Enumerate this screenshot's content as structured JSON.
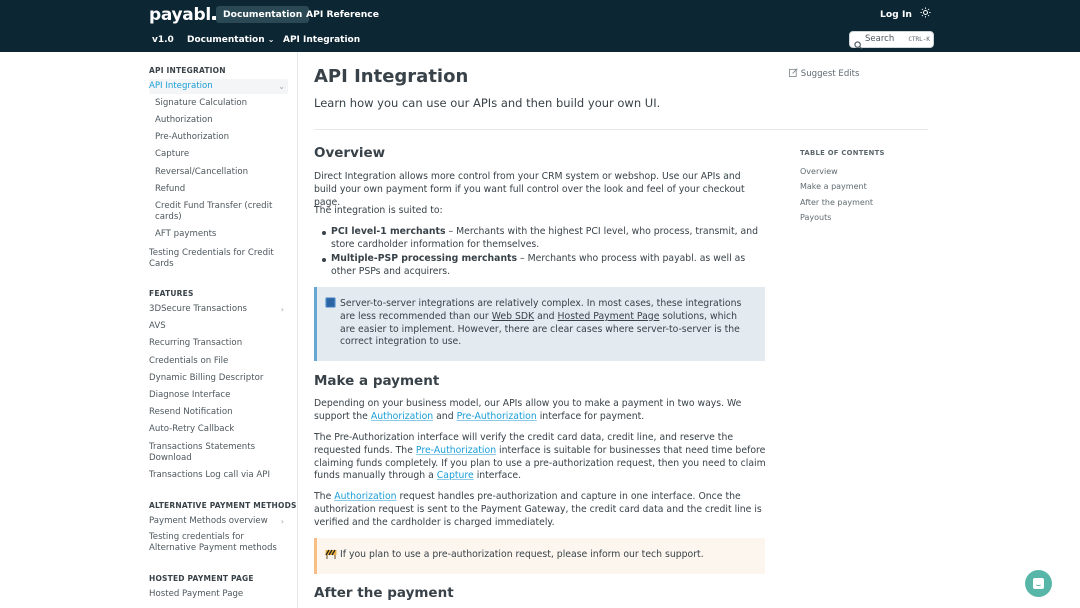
{
  "header": {
    "logo": "payabl",
    "nav": [
      "Documentation",
      "API Reference"
    ],
    "login": "Log In",
    "version": "v1.0",
    "sub_nav": [
      "Documentation",
      "API Integration"
    ],
    "search_placeholder": "Search",
    "search_shortcut": "CTRL-K"
  },
  "sidebar": {
    "sections": [
      {
        "title": "API INTEGRATION",
        "items": [
          "API Integration",
          "Signature Calculation",
          "Authorization",
          "Pre-Authorization",
          "Capture",
          "Reversal/Cancellation",
          "Refund",
          "Credit Fund Transfer (credit cards)",
          "AFT payments",
          "Testing Credentials for Credit Cards"
        ]
      },
      {
        "title": "FEATURES",
        "items": [
          "3DSecure Transactions",
          "AVS",
          "Recurring Transaction",
          "Credentials on File",
          "Dynamic Billing Descriptor",
          "Diagnose Interface",
          "Resend Notification",
          "Auto-Retry Callback",
          "Transactions Statements Download",
          "Transactions Log call via API"
        ]
      },
      {
        "title": "ALTERNATIVE PAYMENT METHODS",
        "items": [
          "Payment Methods overview",
          "Testing credentials for Alternative Payment methods"
        ]
      },
      {
        "title": "HOSTED PAYMENT PAGE",
        "items": [
          "Hosted Payment Page"
        ]
      }
    ]
  },
  "page": {
    "title": "API Integration",
    "lead": "Learn how you can use our APIs and then build your own UI.",
    "suggest": "Suggest Edits",
    "overview_h": "Overview",
    "overview_p1": "Direct Integration allows more control from your CRM system or webshop. Use our APIs and build your own payment form if you want full control over the look and feel of your checkout page.",
    "overview_p2": "The integration is suited to:",
    "bullet1_b": "PCI level-1 merchants",
    "bullet1": " – Merchants with the highest PCI level, who process, transmit, and store cardholder information for themselves.",
    "bullet2_b": "Multiple-PSP processing merchants",
    "bullet2": " – Merchants who process with payabl. as well as other PSPs and acquirers.",
    "callout1_a": "Server-to-server integrations are relatively complex. In most cases, these integrations are less recommended than our ",
    "callout1_link1": "Web SDK",
    "callout1_b": " and ",
    "callout1_link2": "Hosted Payment Page",
    "callout1_c": " solutions, which are easier to implement. However, there are clear cases where server-to-server is the correct integration to use.",
    "make_h": "Make a payment",
    "make_p1_a": "Depending on your business model, our APIs allow you to make a payment in two ways. We support the ",
    "link_auth": "Authorization",
    "and": " and ",
    "link_preauth": "Pre-Authorization",
    "make_p1_b": " interface for payment.",
    "make_p2_a": "The Pre-Authorization interface will verify the credit card data, credit line, and reserve the requested funds. The ",
    "make_p2_b": " interface is suitable for businesses that need time before claiming funds completely. If you plan to use a pre-authorization request, then you need to claim funds manually through a ",
    "link_capture": "Capture",
    "make_p2_c": " interface.",
    "make_p3_a": "The ",
    "make_p3_b": " request handles pre-authorization and capture in one interface. Once the authorization request is sent to the Payment Gateway, the credit card data and the credit line is verified and the cardholder is charged immediately.",
    "callout2": "If you plan to use a pre-authorization request, please inform our tech support.",
    "after_h": "After the payment"
  },
  "toc": {
    "title": "TABLE OF CONTENTS",
    "items": [
      "Overview",
      "Make a payment",
      "After the payment",
      "Payouts"
    ]
  }
}
